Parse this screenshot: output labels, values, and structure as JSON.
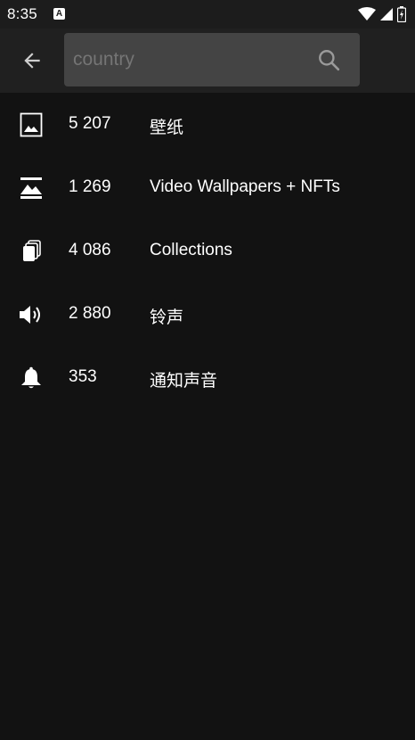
{
  "status_bar": {
    "time": "8:35",
    "notification_badge": "A",
    "icons": [
      "wifi-icon",
      "signal-icon",
      "battery-icon"
    ]
  },
  "app_bar": {
    "back_icon": "arrow-left-icon",
    "search": {
      "value": "",
      "placeholder": "country",
      "icon": "search-icon"
    }
  },
  "results": [
    {
      "icon": "image-icon",
      "count": "5 207",
      "label": "壁纸"
    },
    {
      "icon": "landscape-icon",
      "count": "1 269",
      "label": "Video Wallpapers + NFTs"
    },
    {
      "icon": "collections-icon",
      "count": "4 086",
      "label": "Collections"
    },
    {
      "icon": "speaker-icon",
      "count": "2 880",
      "label": "铃声"
    },
    {
      "icon": "bell-icon",
      "count": "353",
      "label": "通知声音"
    }
  ],
  "colors": {
    "background": "#121212",
    "app_bar": "#202020",
    "search_box": "#444444",
    "placeholder": "#9a9a9a",
    "text": "#ffffff"
  }
}
